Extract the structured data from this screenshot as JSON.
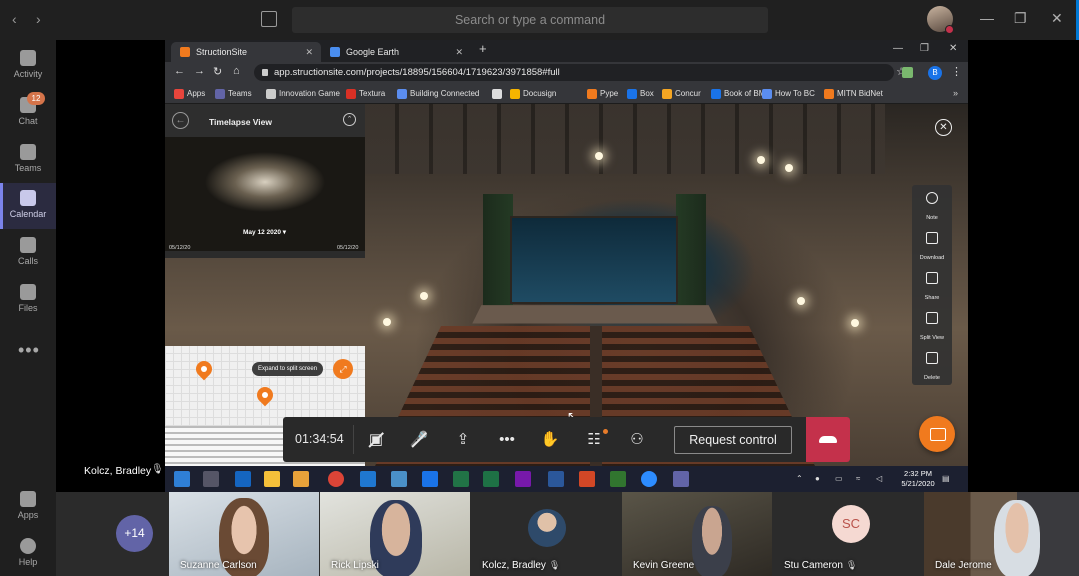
{
  "titlebar": {
    "search_placeholder": "Search or type a command"
  },
  "rail": {
    "items": [
      {
        "label": "Activity"
      },
      {
        "label": "Chat",
        "badge": "12"
      },
      {
        "label": "Teams"
      },
      {
        "label": "Calendar",
        "active": true
      },
      {
        "label": "Calls"
      },
      {
        "label": "Files"
      }
    ],
    "more": "•••",
    "bottom": [
      {
        "label": "Apps"
      },
      {
        "label": "Help"
      }
    ]
  },
  "browser": {
    "tabs": [
      {
        "title": "StructionSite",
        "active": true,
        "icon_color": "#f07a1e"
      },
      {
        "title": "Google Earth",
        "active": false,
        "icon_color": "#4a8ef0"
      }
    ],
    "url": "app.structionsite.com/projects/18895/156604/1719623/3971858#full",
    "profile_initial": "B",
    "bookmarks": [
      {
        "label": "Apps",
        "color": "#e8453c"
      },
      {
        "label": "Teams",
        "color": "#6264a7"
      },
      {
        "label": "Innovation Game",
        "color": "#cccccc"
      },
      {
        "label": "Textura",
        "color": "#d93025"
      },
      {
        "label": "Building Connected",
        "color": "#5b8def"
      },
      {
        "label": "",
        "color": "#dddddd"
      },
      {
        "label": "Docusign",
        "color": "#f5b400"
      },
      {
        "label": "Pype",
        "color": "#f07a1e"
      },
      {
        "label": "Box",
        "color": "#1a73e8"
      },
      {
        "label": "Concur",
        "color": "#f5a623"
      },
      {
        "label": "Book of BM",
        "color": "#1a73e8"
      },
      {
        "label": "How To BC",
        "color": "#5b8def"
      },
      {
        "label": "MITN BidNet",
        "color": "#f07a1e"
      }
    ]
  },
  "viewer": {
    "timelapse_title": "Timelapse View",
    "timelapse_date": "May 12 2020",
    "timelapse_start": "05/12/20",
    "timelapse_end": "05/12/20",
    "expand_tooltip": "Expand to split screen",
    "tools": [
      {
        "label": "Note",
        "icon": "note-icon"
      },
      {
        "label": "Download",
        "icon": "download-icon"
      },
      {
        "label": "Share",
        "icon": "share-icon"
      },
      {
        "label": "Split View",
        "icon": "split-view-icon"
      },
      {
        "label": "Delete",
        "icon": "delete-icon"
      }
    ]
  },
  "taskbar": {
    "time": "2:32 PM",
    "date": "5/21/2020"
  },
  "meeting": {
    "timer": "01:34:54",
    "request_control_label": "Request control",
    "presenter_name": "Kolcz, Bradley",
    "more_participants": "+14",
    "participants": [
      {
        "name": "Suzanne Carlson",
        "muted": false
      },
      {
        "name": "Rick Lipski",
        "muted": false
      },
      {
        "name": "Kolcz, Bradley",
        "muted": true
      },
      {
        "name": "Kevin Greene",
        "muted": false
      },
      {
        "name": "Stu Cameron",
        "muted": true,
        "initials": "SC"
      },
      {
        "name": "Dale Jerome",
        "muted": false
      }
    ]
  },
  "colors": {
    "teams_accent": "#6264a7",
    "hangup_red": "#c4314b",
    "structionsite_orange": "#f07a1e"
  }
}
